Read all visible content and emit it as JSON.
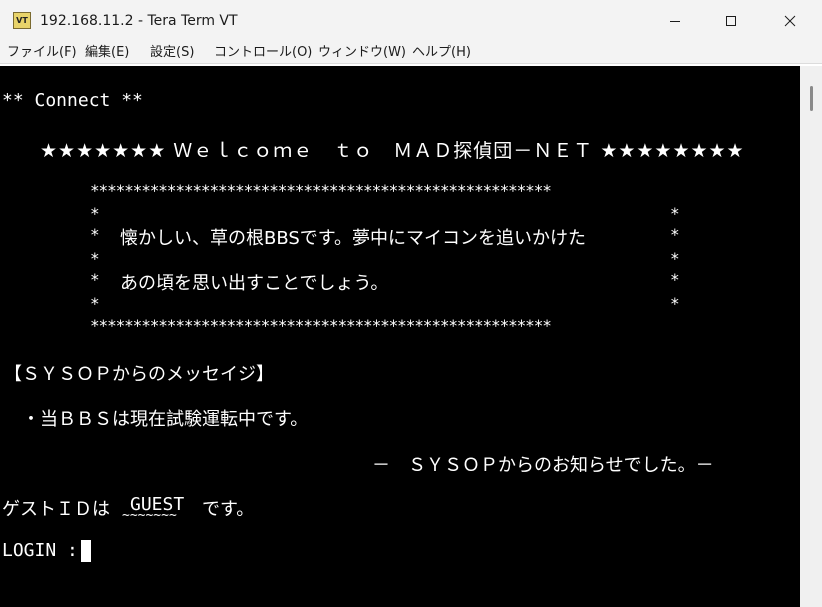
{
  "window": {
    "title": "192.168.11.2 - Tera Term VT",
    "icon_label": "VT"
  },
  "menu": [
    {
      "label": "ファイル(F)"
    },
    {
      "label": "編集(E)"
    },
    {
      "label": "設定(S)"
    },
    {
      "label": "コントロール(O)"
    },
    {
      "label": "ウィンドウ(W)"
    },
    {
      "label": "ヘルプ(H)"
    }
  ],
  "terminal": {
    "connect": "** Connect **",
    "welcome": "★★★★★★★ Ｗｅｌｃｏｍｅ　ｔｏ　ＭＡＤ探偵団－ＮＥＴ ★★★★★★★★",
    "banner_border": "******************************************************",
    "banner_edge_left": "*",
    "banner_edge_right": "*",
    "banner_line1": "懐かしい、草の根BBSです。夢中にマイコンを追いかけた",
    "banner_line2": "あの頃を思い出すことでしょう。",
    "sysop_header": "【ＳＹＳＯＰからのメッセイジ】",
    "sysop_message": "・当ＢＢＳは現在試験運転中です。",
    "sysop_footer": "－　ＳＹＳＯＰからのお知らせでした。－",
    "guest_prefix": "ゲストＩＤは",
    "guest_id": "GUEST",
    "guest_underline": "~~~~~~~",
    "guest_suffix": "です。",
    "login_prompt": "LOGIN : "
  },
  "icons": {
    "app": "tera-term-vt-icon",
    "minimize": "minimize-icon",
    "maximize": "maximize-icon",
    "close": "close-icon"
  }
}
